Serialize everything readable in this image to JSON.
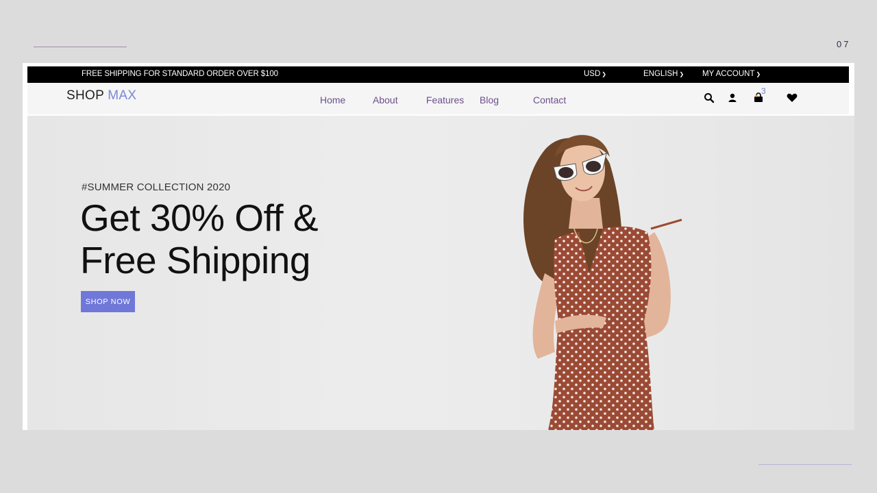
{
  "slide": {
    "number": "07"
  },
  "topbar": {
    "shipping_text": "FREE SHIPPING FOR STANDARD ORDER OVER $100",
    "currency": "USD",
    "language": "ENGLISH",
    "account": "MY ACCOUNT"
  },
  "brand": {
    "name_part1": "SHOP",
    "name_part2": "MAX"
  },
  "nav": {
    "links": [
      "Home",
      "About",
      "Features",
      "Blog",
      "Contact"
    ],
    "cart_count": "3",
    "icons": [
      "search-icon",
      "user-icon",
      "cart-icon",
      "heart-icon"
    ]
  },
  "hero": {
    "kicker": "#SUMMER COLLECTION 2020",
    "title_line1": "Get 30% Off &",
    "title_line2": "Free Shipping",
    "cta_label": "SHOP NOW"
  },
  "colors": {
    "accent": "#6f77d8",
    "nav_link": "#6b4f8a",
    "topbar_bg": "#000000",
    "dress": "#9b4a35"
  }
}
